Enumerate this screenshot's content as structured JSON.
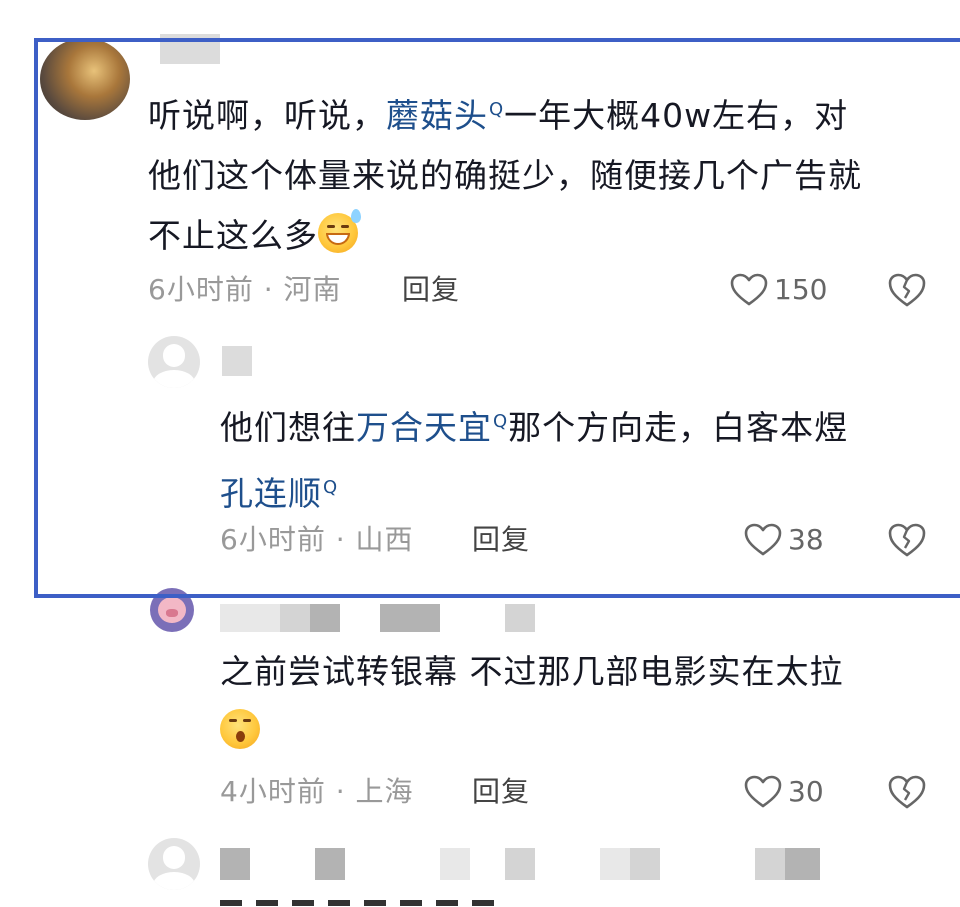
{
  "comments": [
    {
      "text_parts": {
        "a": "听说啊，听说，",
        "link": "蘑菇头",
        "b": "一年大概40w左右，对",
        "line2": "他们这个体量来说的确挺少，随便接几个广告就",
        "line3": "不止这么多"
      },
      "time": "6小时前",
      "location": "河南",
      "reply": "回复",
      "likes": "150"
    },
    {
      "text_parts": {
        "a": "他们想往",
        "link1": "万合天宜",
        "b": "那个方向走，白客本煜",
        "link2": "孔连顺"
      },
      "time": "6小时前",
      "location": "山西",
      "reply": "回复",
      "likes": "38"
    },
    {
      "text_parts": {
        "line1": "之前尝试转银幕 不过那几部电影实在太拉"
      },
      "time": "4小时前",
      "location": "上海",
      "reply": "回复",
      "likes": "30"
    }
  ],
  "search_mark": "Q",
  "meta_separator": "·",
  "icons": {
    "like": "heart-outline-icon",
    "dislike": "broken-heart-icon",
    "search_superscript": "search-icon"
  },
  "colors": {
    "highlight_box": "#3d5fc6",
    "link": "#1e4f8c",
    "meta": "#999999"
  }
}
